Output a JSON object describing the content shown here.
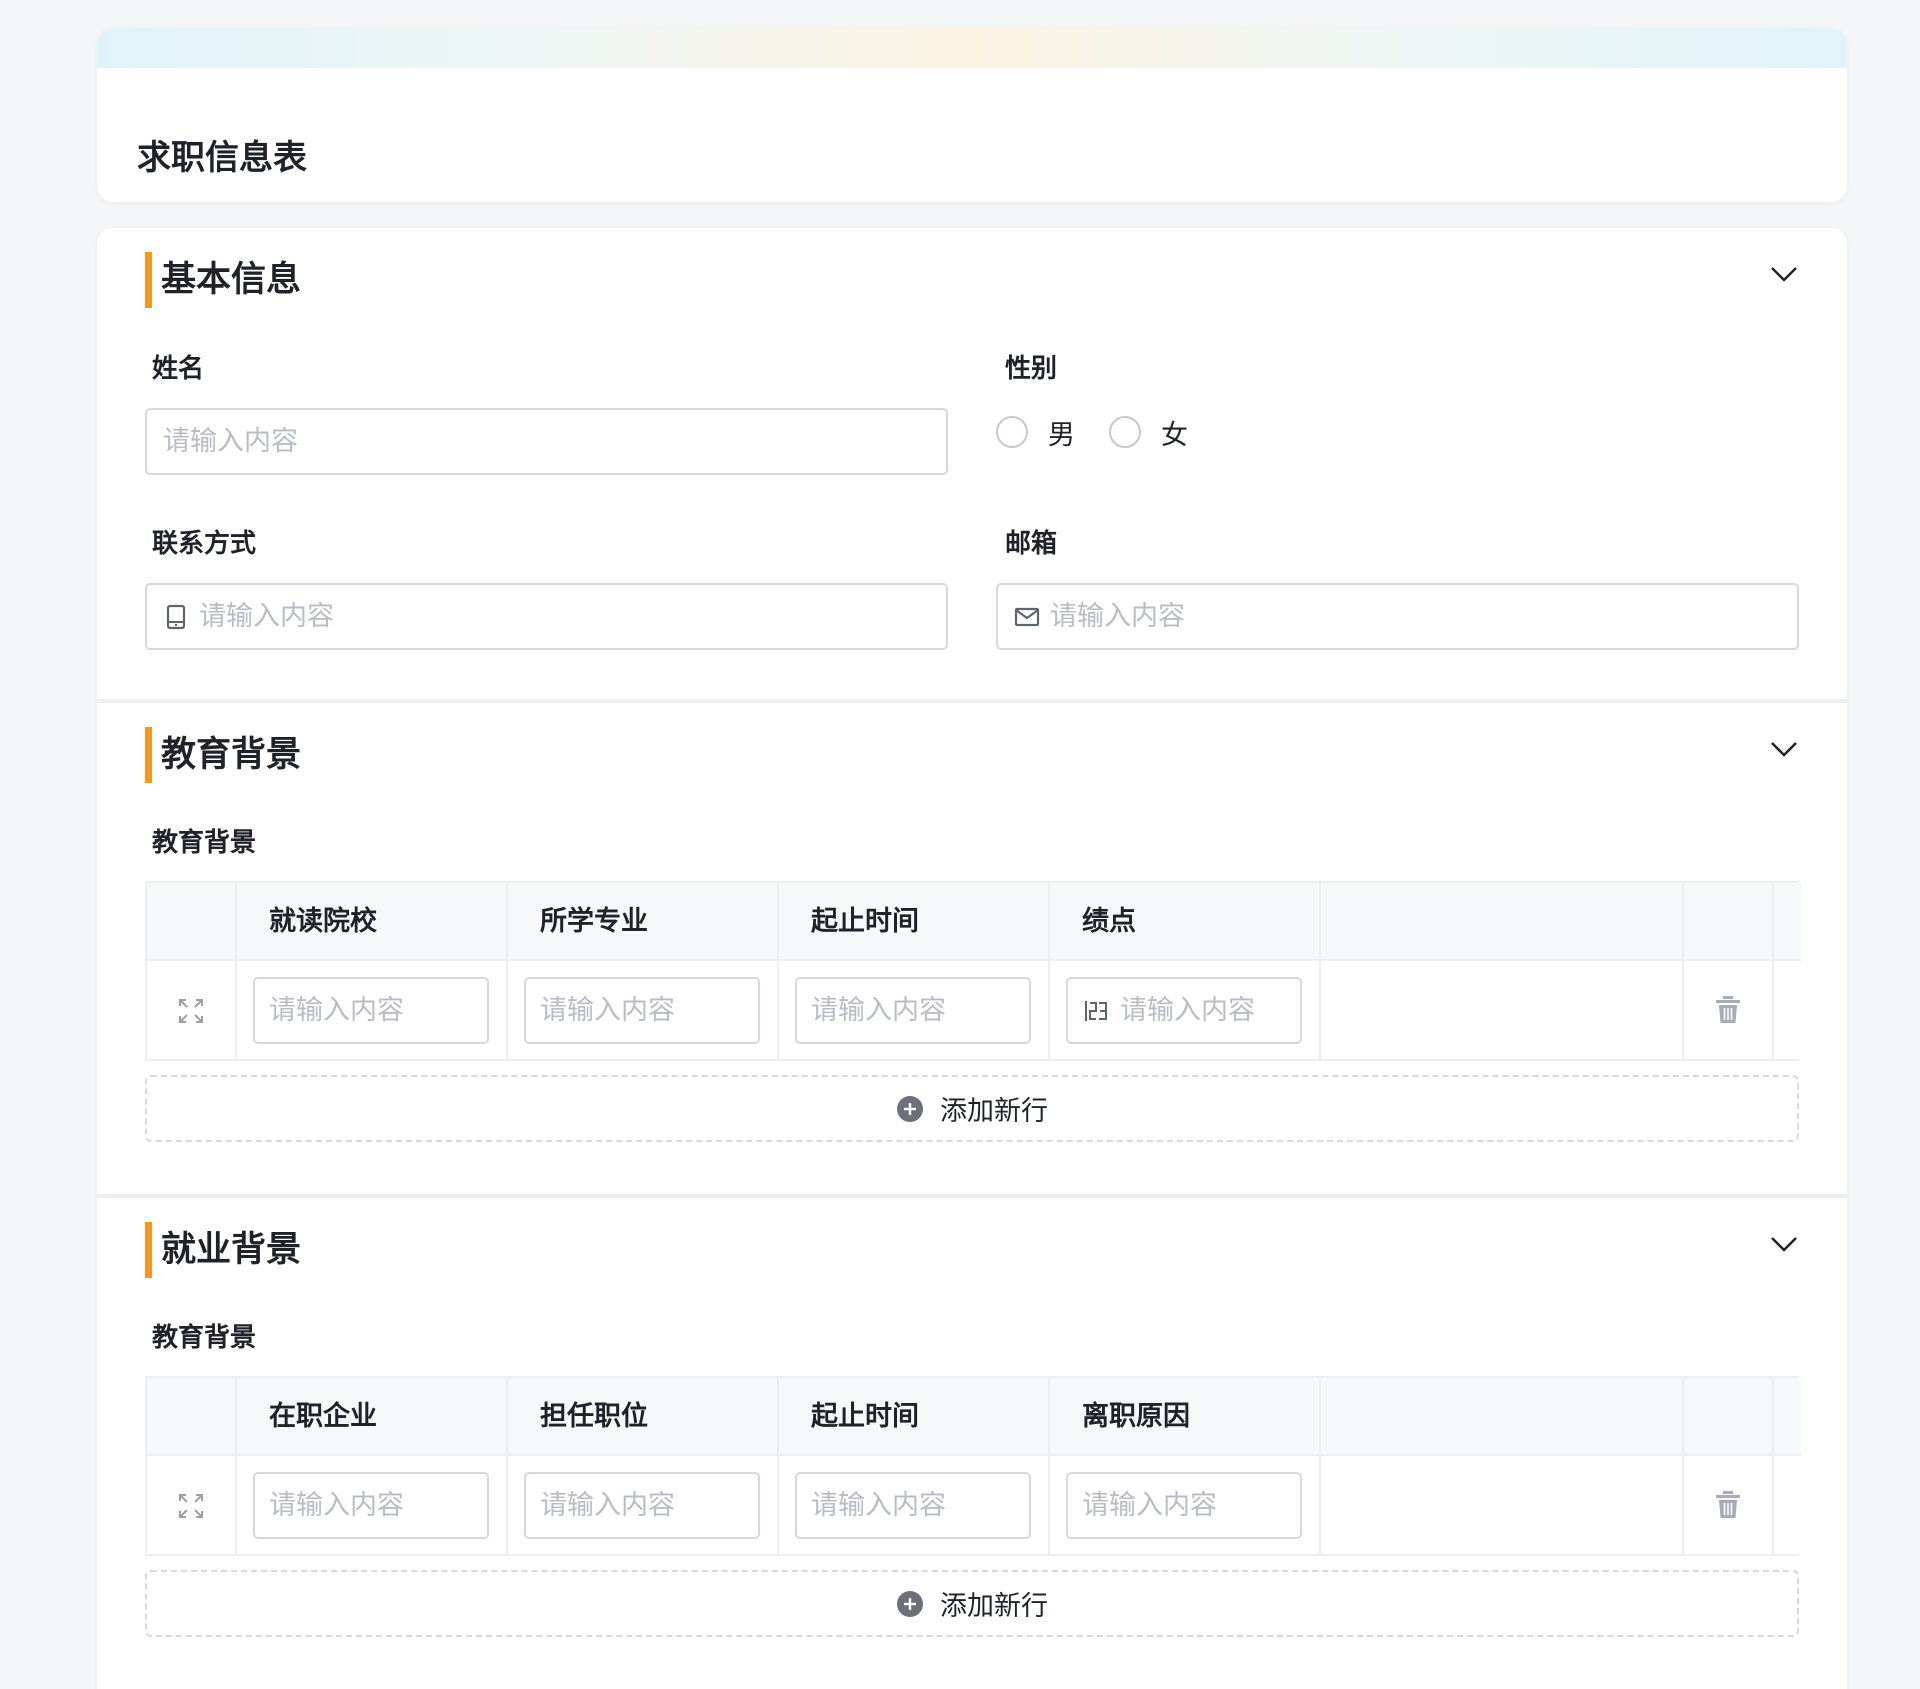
{
  "header": {
    "title": "求职信息表"
  },
  "sections": {
    "basic": {
      "title": "基本信息",
      "name_label": "姓名",
      "name_placeholder": "请输入内容",
      "gender_label": "性别",
      "gender_options": [
        "男",
        "女"
      ],
      "contact_label": "联系方式",
      "contact_placeholder": "请输入内容",
      "email_label": "邮箱",
      "email_placeholder": "请输入内容"
    },
    "education": {
      "title": "教育背景",
      "table_label": "教育背景",
      "columns": [
        "就读院校",
        "所学专业",
        "起止时间",
        "绩点"
      ],
      "placeholder": "请输入内容",
      "add_row_label": "添加新行"
    },
    "employment": {
      "title": "就业背景",
      "table_label": "教育背景",
      "columns": [
        "在职企业",
        "担任职位",
        "起止时间",
        "离职原因"
      ],
      "placeholder": "请输入内容",
      "add_row_label": "添加新行"
    }
  },
  "colors": {
    "accent_bar": "#f7961e",
    "placeholder": "#b8bcc4",
    "border": "#d5d8de"
  },
  "icons": {
    "collapse": "chevron-down-icon",
    "phone": "mobile-phone-icon",
    "email": "envelope-icon",
    "number": "number-123-icon",
    "expand": "expand-icon",
    "delete": "trash-icon",
    "add": "plus-circle-icon"
  }
}
